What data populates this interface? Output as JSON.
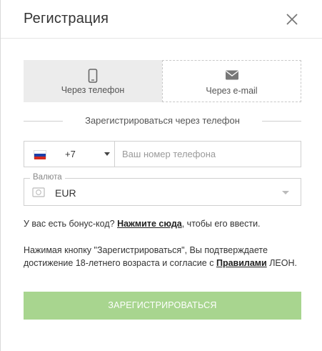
{
  "header": {
    "title": "Регистрация"
  },
  "tabs": [
    {
      "label": "Через телефон",
      "icon": "smartphone-icon",
      "active": true
    },
    {
      "label": "Через e-mail",
      "icon": "envelope-icon",
      "active": false
    }
  ],
  "section_title": "Зарегистрироваться через телефон",
  "phone": {
    "country_flag": "russia-flag-icon",
    "country_code": "+7",
    "placeholder": "Ваш номер телефона",
    "value": ""
  },
  "currency": {
    "label": "Валюта",
    "value": "EUR",
    "icon": "money-icon"
  },
  "bonus": {
    "prefix": "У вас есть бонус-код?",
    "link": "Нажмите сюда",
    "suffix": ", чтобы его ввести."
  },
  "terms": {
    "text": "Нажимая кнопку \"Зарегистрироваться\", Вы подтверждаете достижение 18-летнего возраста и согласие с",
    "link": "Правилами",
    "suffix": "ЛЕОН."
  },
  "submit_label": "ЗАРЕГИСТРИРОВАТЬСЯ",
  "colors": {
    "submit_bg": "#a8d58f",
    "active_tab_bg": "#ececec",
    "border": "#d0d0d0",
    "flag_white": "#ffffff",
    "flag_blue": "#1c3fa8",
    "flag_red": "#d52b1e"
  }
}
